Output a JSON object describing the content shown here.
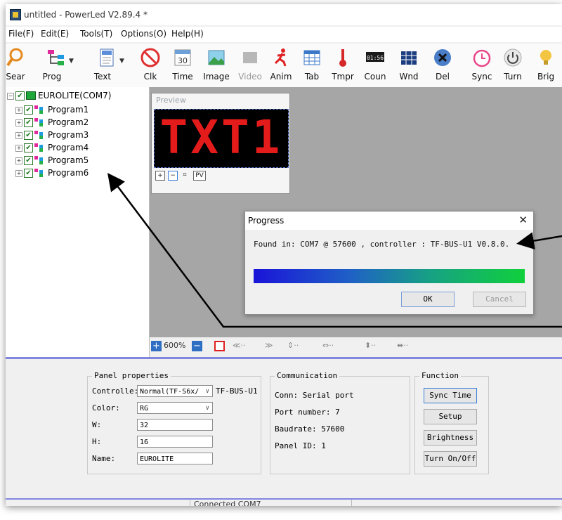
{
  "window": {
    "title": "untitled - PowerLed V2.89.4 *"
  },
  "menu": [
    "File(F)",
    "Edit(E)",
    "Tools(T)",
    "Options(O)",
    "Help(H)"
  ],
  "toolbar": [
    {
      "label": "Sear",
      "icon": "magnifier-icon"
    },
    {
      "label": "Prog",
      "icon": "program-icon"
    },
    {
      "label": "Text",
      "icon": "text-icon"
    },
    {
      "label": "Clk",
      "icon": "clock-icon"
    },
    {
      "label": "Time",
      "icon": "calendar-icon",
      "iconText": "30"
    },
    {
      "label": "Image",
      "icon": "image-icon"
    },
    {
      "label": "Video",
      "icon": "video-icon",
      "disabled": true
    },
    {
      "label": "Anim",
      "icon": "animation-icon"
    },
    {
      "label": "Tab",
      "icon": "table-icon"
    },
    {
      "label": "Tmpr",
      "icon": "thermometer-icon"
    },
    {
      "label": "Coun",
      "icon": "counter-icon",
      "iconText": "01:56"
    },
    {
      "label": "Wnd",
      "icon": "window-icon"
    },
    {
      "label": "Del",
      "icon": "delete-icon"
    },
    {
      "label": "Sync",
      "icon": "alarm-clock-icon"
    },
    {
      "label": "Turn",
      "icon": "power-icon"
    },
    {
      "label": "Brig",
      "icon": "bulb-icon"
    }
  ],
  "tree": {
    "root": "EUROLITE(COM7)",
    "programs": [
      "Program1",
      "Program2",
      "Program3",
      "Program4",
      "Program5",
      "Program6"
    ]
  },
  "preview": {
    "label": "Preview",
    "led_text": "TXT1",
    "buttons": [
      "+",
      "−",
      "⌗",
      "PV"
    ]
  },
  "dialog": {
    "title": "Progress",
    "close": "✕",
    "message": "Found in: COM7 @ 57600 , controller : TF-BUS-U1 V0.8.0.",
    "progress": 1.0,
    "ok": "OK",
    "cancel": "Cancel"
  },
  "zoom": {
    "value": "600%"
  },
  "panel": {
    "title": "Panel properties",
    "controller_label": "Controlle:",
    "controller_value": "Normal(TF-S6x/",
    "controller_extra": "TF-BUS-U1",
    "color_label": "Color:",
    "color_value": "RG",
    "w_label": "W:",
    "w_value": "32",
    "h_label": "H:",
    "h_value": "16",
    "name_label": "Name:",
    "name_value": "EUROLITE"
  },
  "communication": {
    "title": "Communication",
    "conn": "Conn: Serial port",
    "port": "Port number: 7",
    "baud": "Baudrate: 57600",
    "panel_id": "Panel ID: 1"
  },
  "function": {
    "title": "Function",
    "sync": "Sync Time",
    "setup": "Setup",
    "brightness": "Brightness",
    "turn": "Turn On/Off"
  },
  "status": {
    "text": "Connected COM7"
  },
  "colors": {
    "accent": "#7f87e0",
    "led": "#e31b1b",
    "progress_start": "#1a14d8",
    "progress_end": "#10d03c"
  }
}
